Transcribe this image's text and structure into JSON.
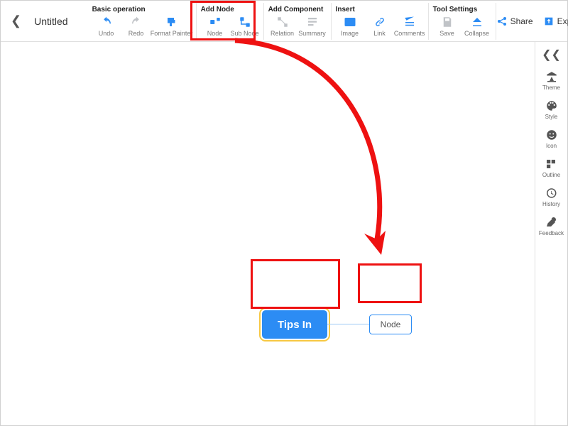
{
  "header": {
    "title": "Untitled",
    "groups": {
      "basic": {
        "label": "Basic operation",
        "undo": "Undo",
        "redo": "Redo",
        "format_painter": "Format Painter"
      },
      "addnode": {
        "label": "Add Node",
        "node": "Node",
        "subnode": "Sub Node"
      },
      "addcomp": {
        "label": "Add Component",
        "relation": "Relation",
        "summary": "Summary"
      },
      "insert": {
        "label": "Insert",
        "image": "Image",
        "link": "Link",
        "comments": "Comments"
      },
      "tool": {
        "label": "Tool Settings",
        "save": "Save",
        "collapse": "Collapse"
      }
    },
    "share": "Share",
    "export": "Export"
  },
  "sidebar": {
    "theme": "Theme",
    "style": "Style",
    "icon": "Icon",
    "outline": "Outline",
    "history": "History",
    "feedback": "Feedback"
  },
  "canvas": {
    "main": "Tips  In",
    "child": "Node"
  }
}
